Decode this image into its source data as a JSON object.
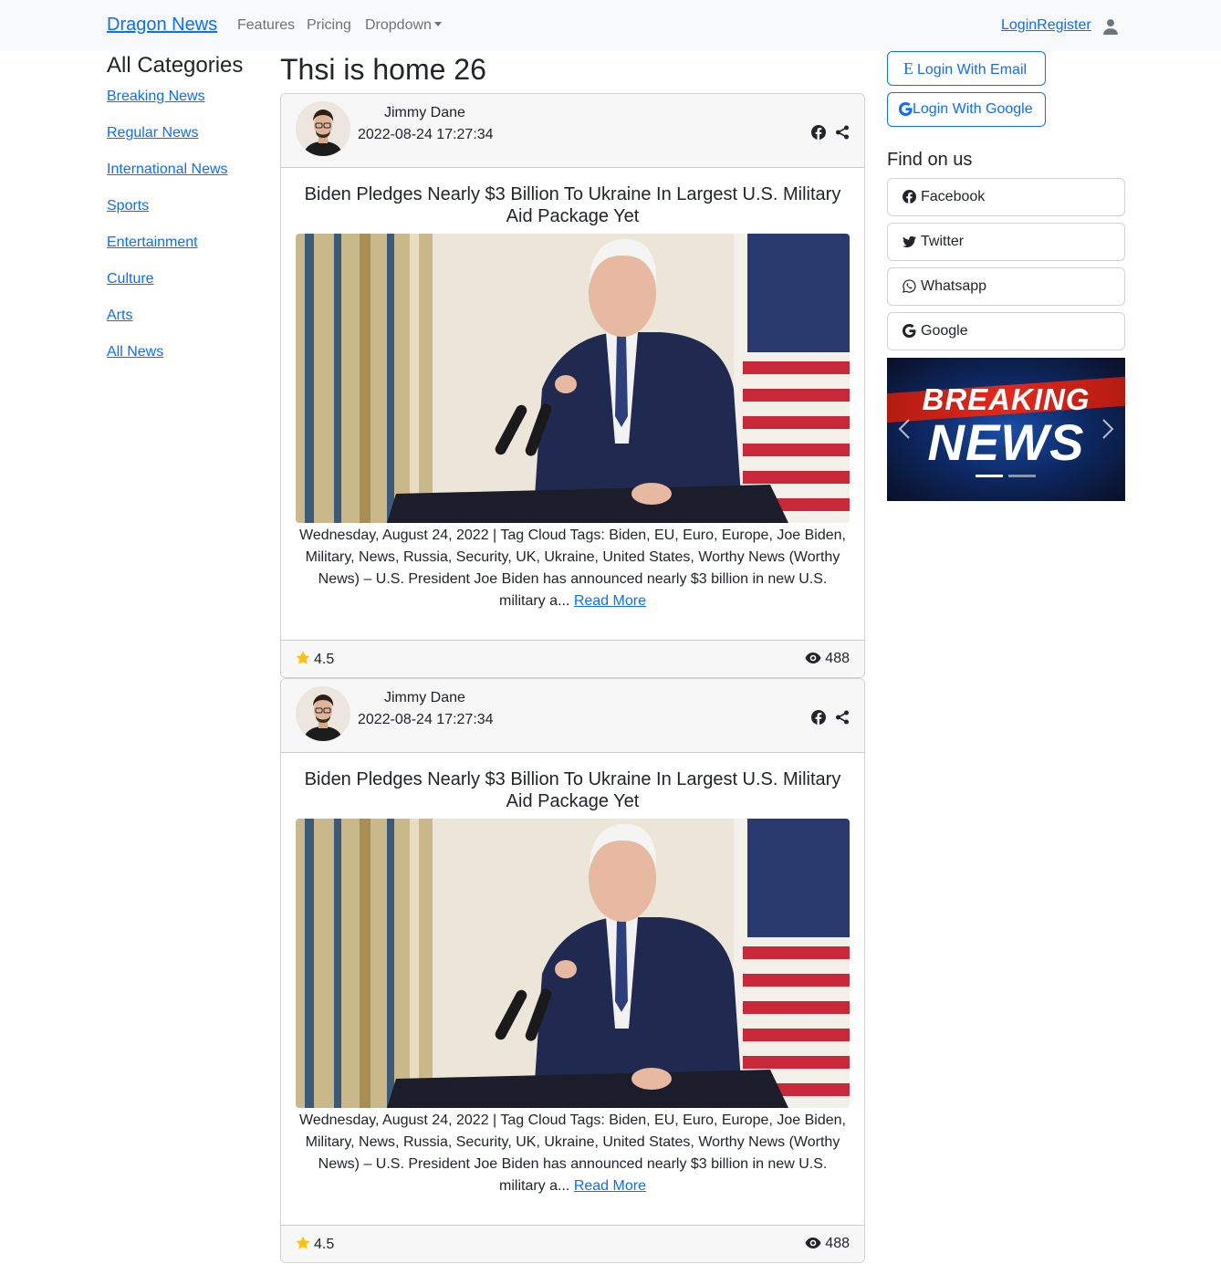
{
  "nav": {
    "brand": "Dragon News",
    "features": "Features",
    "pricing": "Pricing",
    "dropdown": "Dropdown",
    "auth": "LoginRegister"
  },
  "categories": {
    "title": "All Categories",
    "items": [
      "Breaking News",
      "Regular News",
      "International News",
      "Sports",
      "Entertainment",
      "Culture",
      "Arts",
      "All News"
    ]
  },
  "page_title": "Thsi is home 26",
  "articles": [
    {
      "author": "Jimmy Dane",
      "date": "2022-08-24 17:27:34",
      "title": "Biden Pledges Nearly $3 Billion To Ukraine In Largest U.S. Military Aid Package Yet",
      "excerpt": "Wednesday, August 24, 2022 | Tag Cloud Tags: Biden, EU, Euro, Europe, Joe Biden, Military, News, Russia, Security, UK, Ukraine, United States, Worthy News (Worthy News) – U.S. President Joe Biden has announced nearly $3 billion in new U.S. military a...",
      "read_more": "Read More",
      "rating": "4.5",
      "views": "488"
    },
    {
      "author": "Jimmy Dane",
      "date": "2022-08-24 17:27:34",
      "title": "Biden Pledges Nearly $3 Billion To Ukraine In Largest U.S. Military Aid Package Yet",
      "excerpt": "Wednesday, August 24, 2022 | Tag Cloud Tags: Biden, EU, Euro, Europe, Joe Biden, Military, News, Russia, Security, UK, Ukraine, United States, Worthy News (Worthy News) – U.S. President Joe Biden has announced nearly $3 billion in new U.S. military a...",
      "read_more": "Read More",
      "rating": "4.5",
      "views": "488"
    }
  ],
  "login": {
    "email_icon": "E",
    "email": "Login With Email",
    "google": "Login With Google"
  },
  "find_us": {
    "title": "Find on us",
    "items": [
      "Facebook",
      "Twitter",
      "Whatsapp",
      "Google"
    ]
  },
  "carousel": {
    "line1": "BREAKING",
    "line2": "NEWS"
  },
  "colors": {
    "accent": "#0d6efd",
    "star": "#ffc107",
    "navbar_bg": "#f8f9fa"
  }
}
